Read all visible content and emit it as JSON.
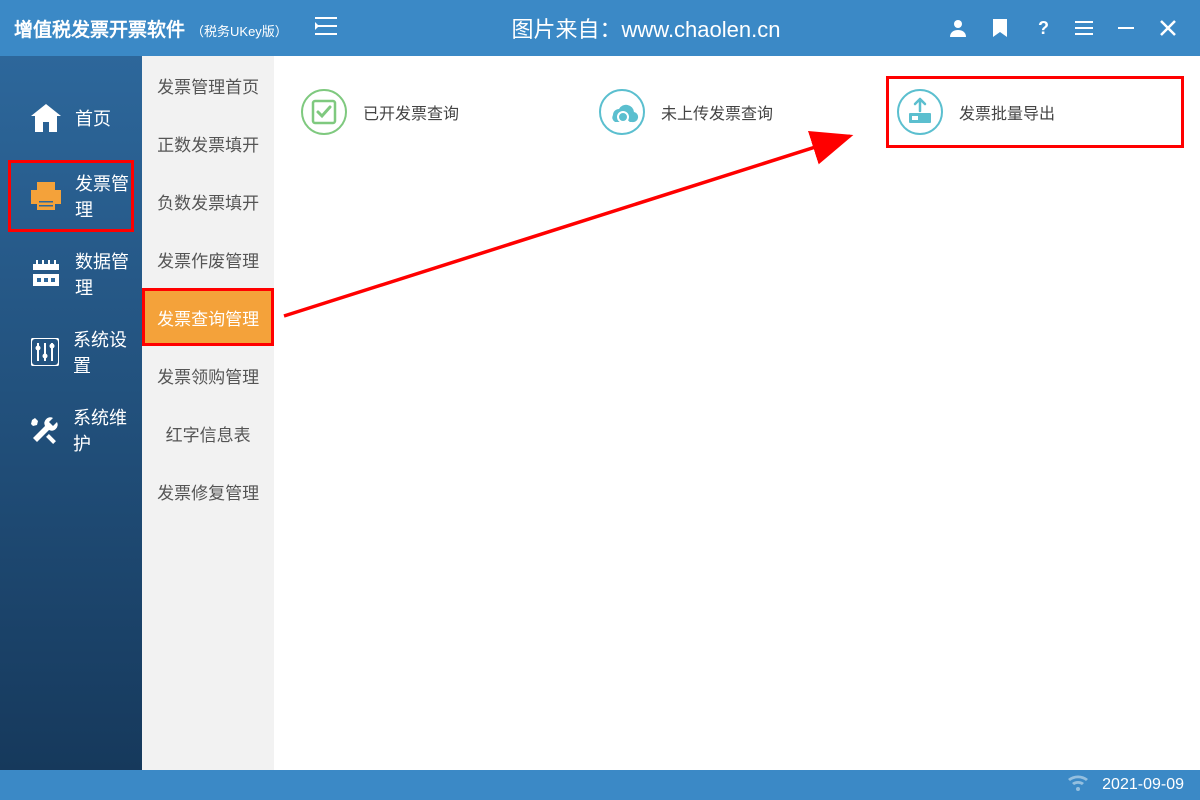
{
  "titlebar": {
    "app_title": "增值税发票开票软件",
    "app_subtitle": "（税务UKey版）",
    "source_text": "图片来自：www.chaolen.cn"
  },
  "nav": [
    {
      "id": "home",
      "label": "首页",
      "highlighted": false
    },
    {
      "id": "invoice-mgmt",
      "label": "发票管理",
      "highlighted": true
    },
    {
      "id": "data-mgmt",
      "label": "数据管理",
      "highlighted": false
    },
    {
      "id": "system-settings",
      "label": "系统设置",
      "highlighted": false
    },
    {
      "id": "system-maint",
      "label": "系统维护",
      "highlighted": false
    }
  ],
  "subnav": [
    {
      "id": "home",
      "label": "发票管理首页",
      "active": false,
      "highlighted": false
    },
    {
      "id": "positive",
      "label": "正数发票填开",
      "active": false,
      "highlighted": false
    },
    {
      "id": "negative",
      "label": "负数发票填开",
      "active": false,
      "highlighted": false
    },
    {
      "id": "void",
      "label": "发票作废管理",
      "active": false,
      "highlighted": false
    },
    {
      "id": "query",
      "label": "发票查询管理",
      "active": true,
      "highlighted": true
    },
    {
      "id": "purchase",
      "label": "发票领购管理",
      "active": false,
      "highlighted": false
    },
    {
      "id": "red",
      "label": "红字信息表",
      "active": false,
      "highlighted": false
    },
    {
      "id": "repair",
      "label": "发票修复管理",
      "active": false,
      "highlighted": false
    }
  ],
  "actions": [
    {
      "id": "issued-query",
      "label": "已开发票查询",
      "highlighted": false,
      "icon": "check-green"
    },
    {
      "id": "unuploaded-query",
      "label": "未上传发票查询",
      "highlighted": false,
      "icon": "cloud-search"
    },
    {
      "id": "batch-export",
      "label": "发票批量导出",
      "highlighted": true,
      "icon": "export-disk"
    }
  ],
  "statusbar": {
    "date": "2021-09-09"
  },
  "annotation": {
    "arrow_color": "#ff0000"
  }
}
